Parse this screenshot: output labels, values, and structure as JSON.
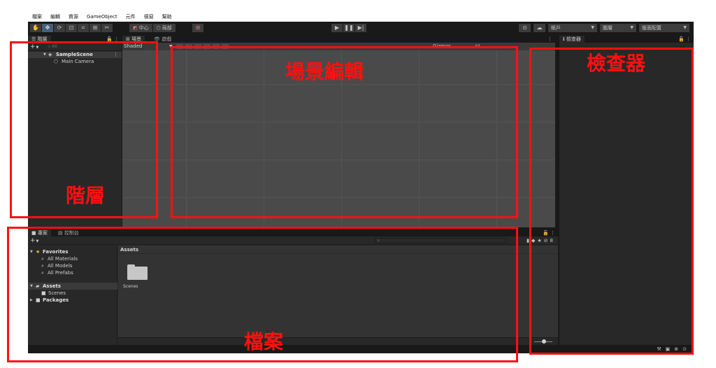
{
  "menu": [
    "檔案",
    "編輯",
    "資源",
    "GameObject",
    "元件",
    "視窗",
    "幫助"
  ],
  "toolbar": {
    "pivot_center": "中心",
    "pivot_local": "局部",
    "account": "帳戶",
    "layers": "圖層",
    "layout": "版面配置"
  },
  "hierarchy": {
    "tab": "階層",
    "search_placeholder": "All",
    "scene": "SampleScene",
    "items": [
      "Main Camera"
    ]
  },
  "scene_view": {
    "tabs": [
      "場景",
      "遊戲"
    ],
    "shading": "Shaded",
    "gizmos": "Gizmos",
    "filter": "All"
  },
  "project": {
    "tabs": [
      "專案",
      "控制台"
    ],
    "favorites_label": "Favorites",
    "favorites": [
      "All Materials",
      "All Models",
      "All Prefabs"
    ],
    "assets_label": "Assets",
    "asset_children": [
      "Scenes"
    ],
    "packages_label": "Packages",
    "breadcrumb": "Assets",
    "folder_items": [
      "Scenes"
    ]
  },
  "inspector": {
    "tab": "檢查器"
  },
  "annotations": {
    "scene": "場景編輯",
    "inspector": "檢查器",
    "hierarchy": "階層",
    "project": "檔案"
  },
  "colors": {
    "annotation": "#ff1010",
    "editor_bg": "#191919",
    "panel_bg": "#282828"
  }
}
